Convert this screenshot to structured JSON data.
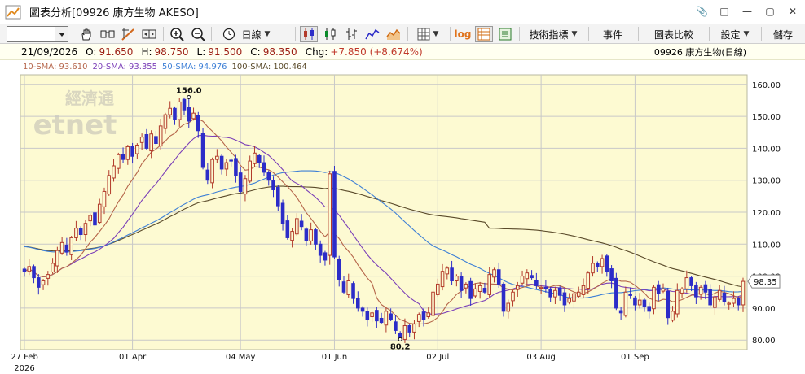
{
  "window": {
    "title": "圖表分析[09926 康方生物 AKESO]",
    "controls": [
      "📎",
      "□",
      "—",
      "▢",
      "✕"
    ]
  },
  "toolbar": {
    "code_value": "",
    "period_label": "日線",
    "log_label": "log",
    "indicators_label": "技術指標",
    "events_label": "事件",
    "compare_label": "圖表比較",
    "settings_label": "設定",
    "save_label": "儲存"
  },
  "quote": {
    "date": "21/09/2026",
    "open_label": "O:",
    "open": "91.650",
    "high_label": "H:",
    "high": "98.750",
    "low_label": "L:",
    "low": "91.500",
    "close_label": "C:",
    "close": "98.350",
    "chg_label": "Chg:",
    "chg": "+7.850 (+8.674%)",
    "stock": "09926  康方生物(日線)"
  },
  "sma_legend": [
    {
      "label": "10-SMA: 93.610",
      "color": "#b5654a"
    },
    {
      "label": "20-SMA: 93.355",
      "color": "#7b3fb8"
    },
    {
      "label": "50-SMA: 94.976",
      "color": "#3d7fd6"
    },
    {
      "label": "100-SMA: 100.464",
      "color": "#5a4a2a"
    }
  ],
  "colors": {
    "up": "#b23a2a",
    "down": "#2c2cc8",
    "plot_bg": "#fdfad2",
    "grid": "#c8c8c8",
    "sma10": "#b5654a",
    "sma20": "#7b3fb8",
    "sma50": "#3d7fd6",
    "sma100": "#5a4a2a"
  },
  "chart_data": {
    "type": "candlestick",
    "ylim": [
      77,
      163
    ],
    "yticks": [
      "160.00",
      "150.00",
      "140.00",
      "130.00",
      "120.00",
      "110.00",
      "100.00",
      "90.00",
      "80.00"
    ],
    "ytick_values": [
      160,
      150,
      140,
      130,
      120,
      110,
      100,
      90,
      80
    ],
    "last_price_label": "98.35",
    "last_price": 98.35,
    "xticks": [
      {
        "label": "27 Feb",
        "sub": "2026",
        "index": 0
      },
      {
        "label": "01 Apr",
        "sub": "",
        "index": 23
      },
      {
        "label": "04 May",
        "sub": "",
        "index": 46
      },
      {
        "label": "01 Jun",
        "sub": "",
        "index": 66
      },
      {
        "label": "02 Jul",
        "sub": "",
        "index": 88
      },
      {
        "label": "03 Aug",
        "sub": "",
        "index": 110
      },
      {
        "label": "01 Sep",
        "sub": "",
        "index": 130
      }
    ],
    "annotations": [
      {
        "text": "156.0",
        "index": 35,
        "value": 156.0,
        "pos": "above"
      },
      {
        "text": "80.2",
        "index": 80,
        "value": 80.2,
        "pos": "below"
      }
    ],
    "closes": [
      101.5,
      103.0,
      99.5,
      96.5,
      98.5,
      100.5,
      104.0,
      108.0,
      110.5,
      107.5,
      112.0,
      115.0,
      113.0,
      116.5,
      119.0,
      116.0,
      122.5,
      126.5,
      131.5,
      134.5,
      138.0,
      136.5,
      140.5,
      137.5,
      141.0,
      143.5,
      140.0,
      144.5,
      141.5,
      147.0,
      150.5,
      152.5,
      149.0,
      154.5,
      152.0,
      148.5,
      151.0,
      145.5,
      134.0,
      130.0,
      136.5,
      137.5,
      133.5,
      135.5,
      136.0,
      131.5,
      126.5,
      130.5,
      136.0,
      138.5,
      135.5,
      132.5,
      130.0,
      127.0,
      122.0,
      116.5,
      112.0,
      114.0,
      118.0,
      115.5,
      111.0,
      114.5,
      110.0,
      106.5,
      105.0,
      132.0,
      106.0,
      99.0,
      95.0,
      98.5,
      93.0,
      90.0,
      89.0,
      86.5,
      88.5,
      86.0,
      85.5,
      89.0,
      86.5,
      83.0,
      80.2,
      84.5,
      82.5,
      85.0,
      88.0,
      86.5,
      88.5,
      95.0,
      97.5,
      101.5,
      102.5,
      98.5,
      100.0,
      95.5,
      97.5,
      93.0,
      96.0,
      97.0,
      95.0,
      100.5,
      102.0,
      97.5,
      89.0,
      91.5,
      95.0,
      97.0,
      100.0,
      101.0,
      99.5,
      97.0,
      96.5,
      96.0,
      93.5,
      95.5,
      94.0,
      91.0,
      93.0,
      94.5,
      95.0,
      97.0,
      101.0,
      104.0,
      103.0,
      105.5,
      101.5,
      98.5,
      90.0,
      88.5,
      95.0,
      94.0,
      91.0,
      92.5,
      90.5,
      89.0,
      96.5,
      94.5,
      96.0,
      87.0,
      89.0,
      95.5,
      96.0,
      99.5,
      97.0,
      93.5,
      96.5,
      95.0,
      91.0,
      93.5,
      95.5,
      92.0,
      91.5,
      93.0,
      91.0,
      98.35
    ],
    "sma_last": {
      "sma10": 93.61,
      "sma20": 93.355,
      "sma50": 94.976,
      "sma100": 100.464
    }
  },
  "watermark": {
    "cn": "經濟通",
    "en": "etnet"
  }
}
